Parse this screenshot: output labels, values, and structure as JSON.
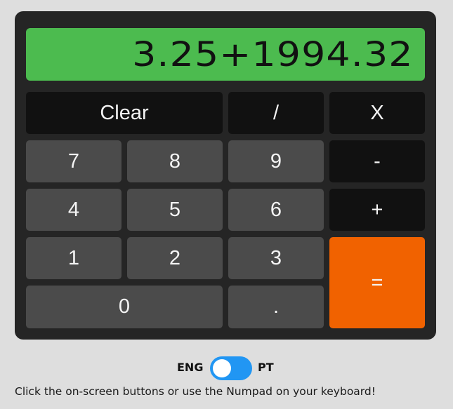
{
  "display": {
    "value": "3.25+1994.32"
  },
  "keys": {
    "clear": "Clear",
    "divide": "/",
    "multiply": "X",
    "seven": "7",
    "eight": "8",
    "nine": "9",
    "minus": "-",
    "four": "4",
    "five": "5",
    "six": "6",
    "plus": "+",
    "one": "1",
    "two": "2",
    "three": "3",
    "equals": "=",
    "zero": "0",
    "decimal": "."
  },
  "language": {
    "left_label": "ENG",
    "right_label": "PT",
    "toggle_color": "#2196f3"
  },
  "hint": "Click the on-screen buttons or use the Numpad on your keyboard!",
  "colors": {
    "display_bg": "#4cbb4f",
    "calculator_bg": "#252525",
    "operator_key": "#111111",
    "number_key": "#4b4b4b",
    "equals_key": "#f16200"
  }
}
